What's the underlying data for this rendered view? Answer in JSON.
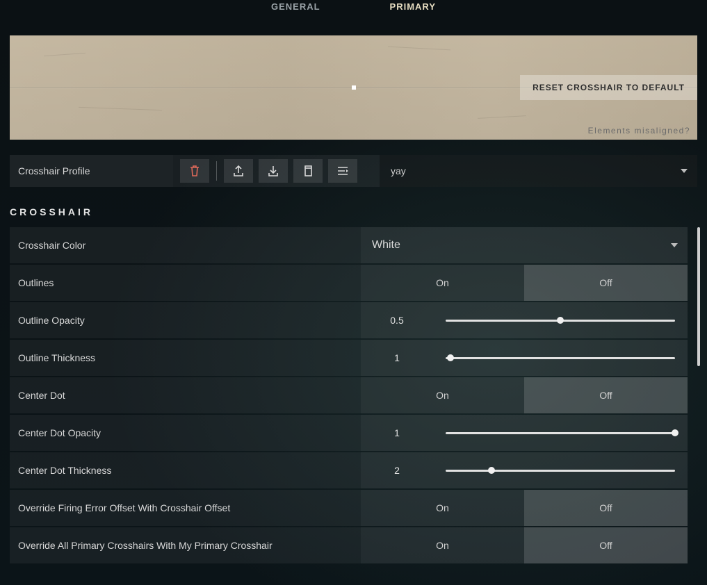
{
  "tabs": {
    "general": "GENERAL",
    "primary": "PRIMARY",
    "active": "primary"
  },
  "preview": {
    "reset_label": "RESET CROSSHAIR TO DEFAULT",
    "misaligned_label": "Elements misaligned?"
  },
  "profile": {
    "label": "Crosshair Profile",
    "selected": "yay",
    "icons": {
      "trash": "trash-icon",
      "export": "export-icon",
      "import": "import-icon",
      "copy": "copy-icon",
      "list": "list-icon"
    }
  },
  "section_title": "CROSSHAIR",
  "on_label": "On",
  "off_label": "Off",
  "rows": {
    "color": {
      "label": "Crosshair Color",
      "value": "White"
    },
    "outlines": {
      "label": "Outlines",
      "selected": "off"
    },
    "outline_opacity": {
      "label": "Outline Opacity",
      "value": "0.5",
      "pct": 50
    },
    "outline_thickness": {
      "label": "Outline Thickness",
      "value": "1",
      "pct": 2
    },
    "center_dot": {
      "label": "Center Dot",
      "selected": "off"
    },
    "center_dot_opacity": {
      "label": "Center Dot Opacity",
      "value": "1",
      "pct": 100
    },
    "center_dot_thick": {
      "label": "Center Dot Thickness",
      "value": "2",
      "pct": 20
    },
    "override_firing": {
      "label": "Override Firing Error Offset With Crosshair Offset",
      "selected": "off"
    },
    "override_all": {
      "label": "Override All Primary Crosshairs With My Primary Crosshair",
      "selected": "off"
    }
  }
}
